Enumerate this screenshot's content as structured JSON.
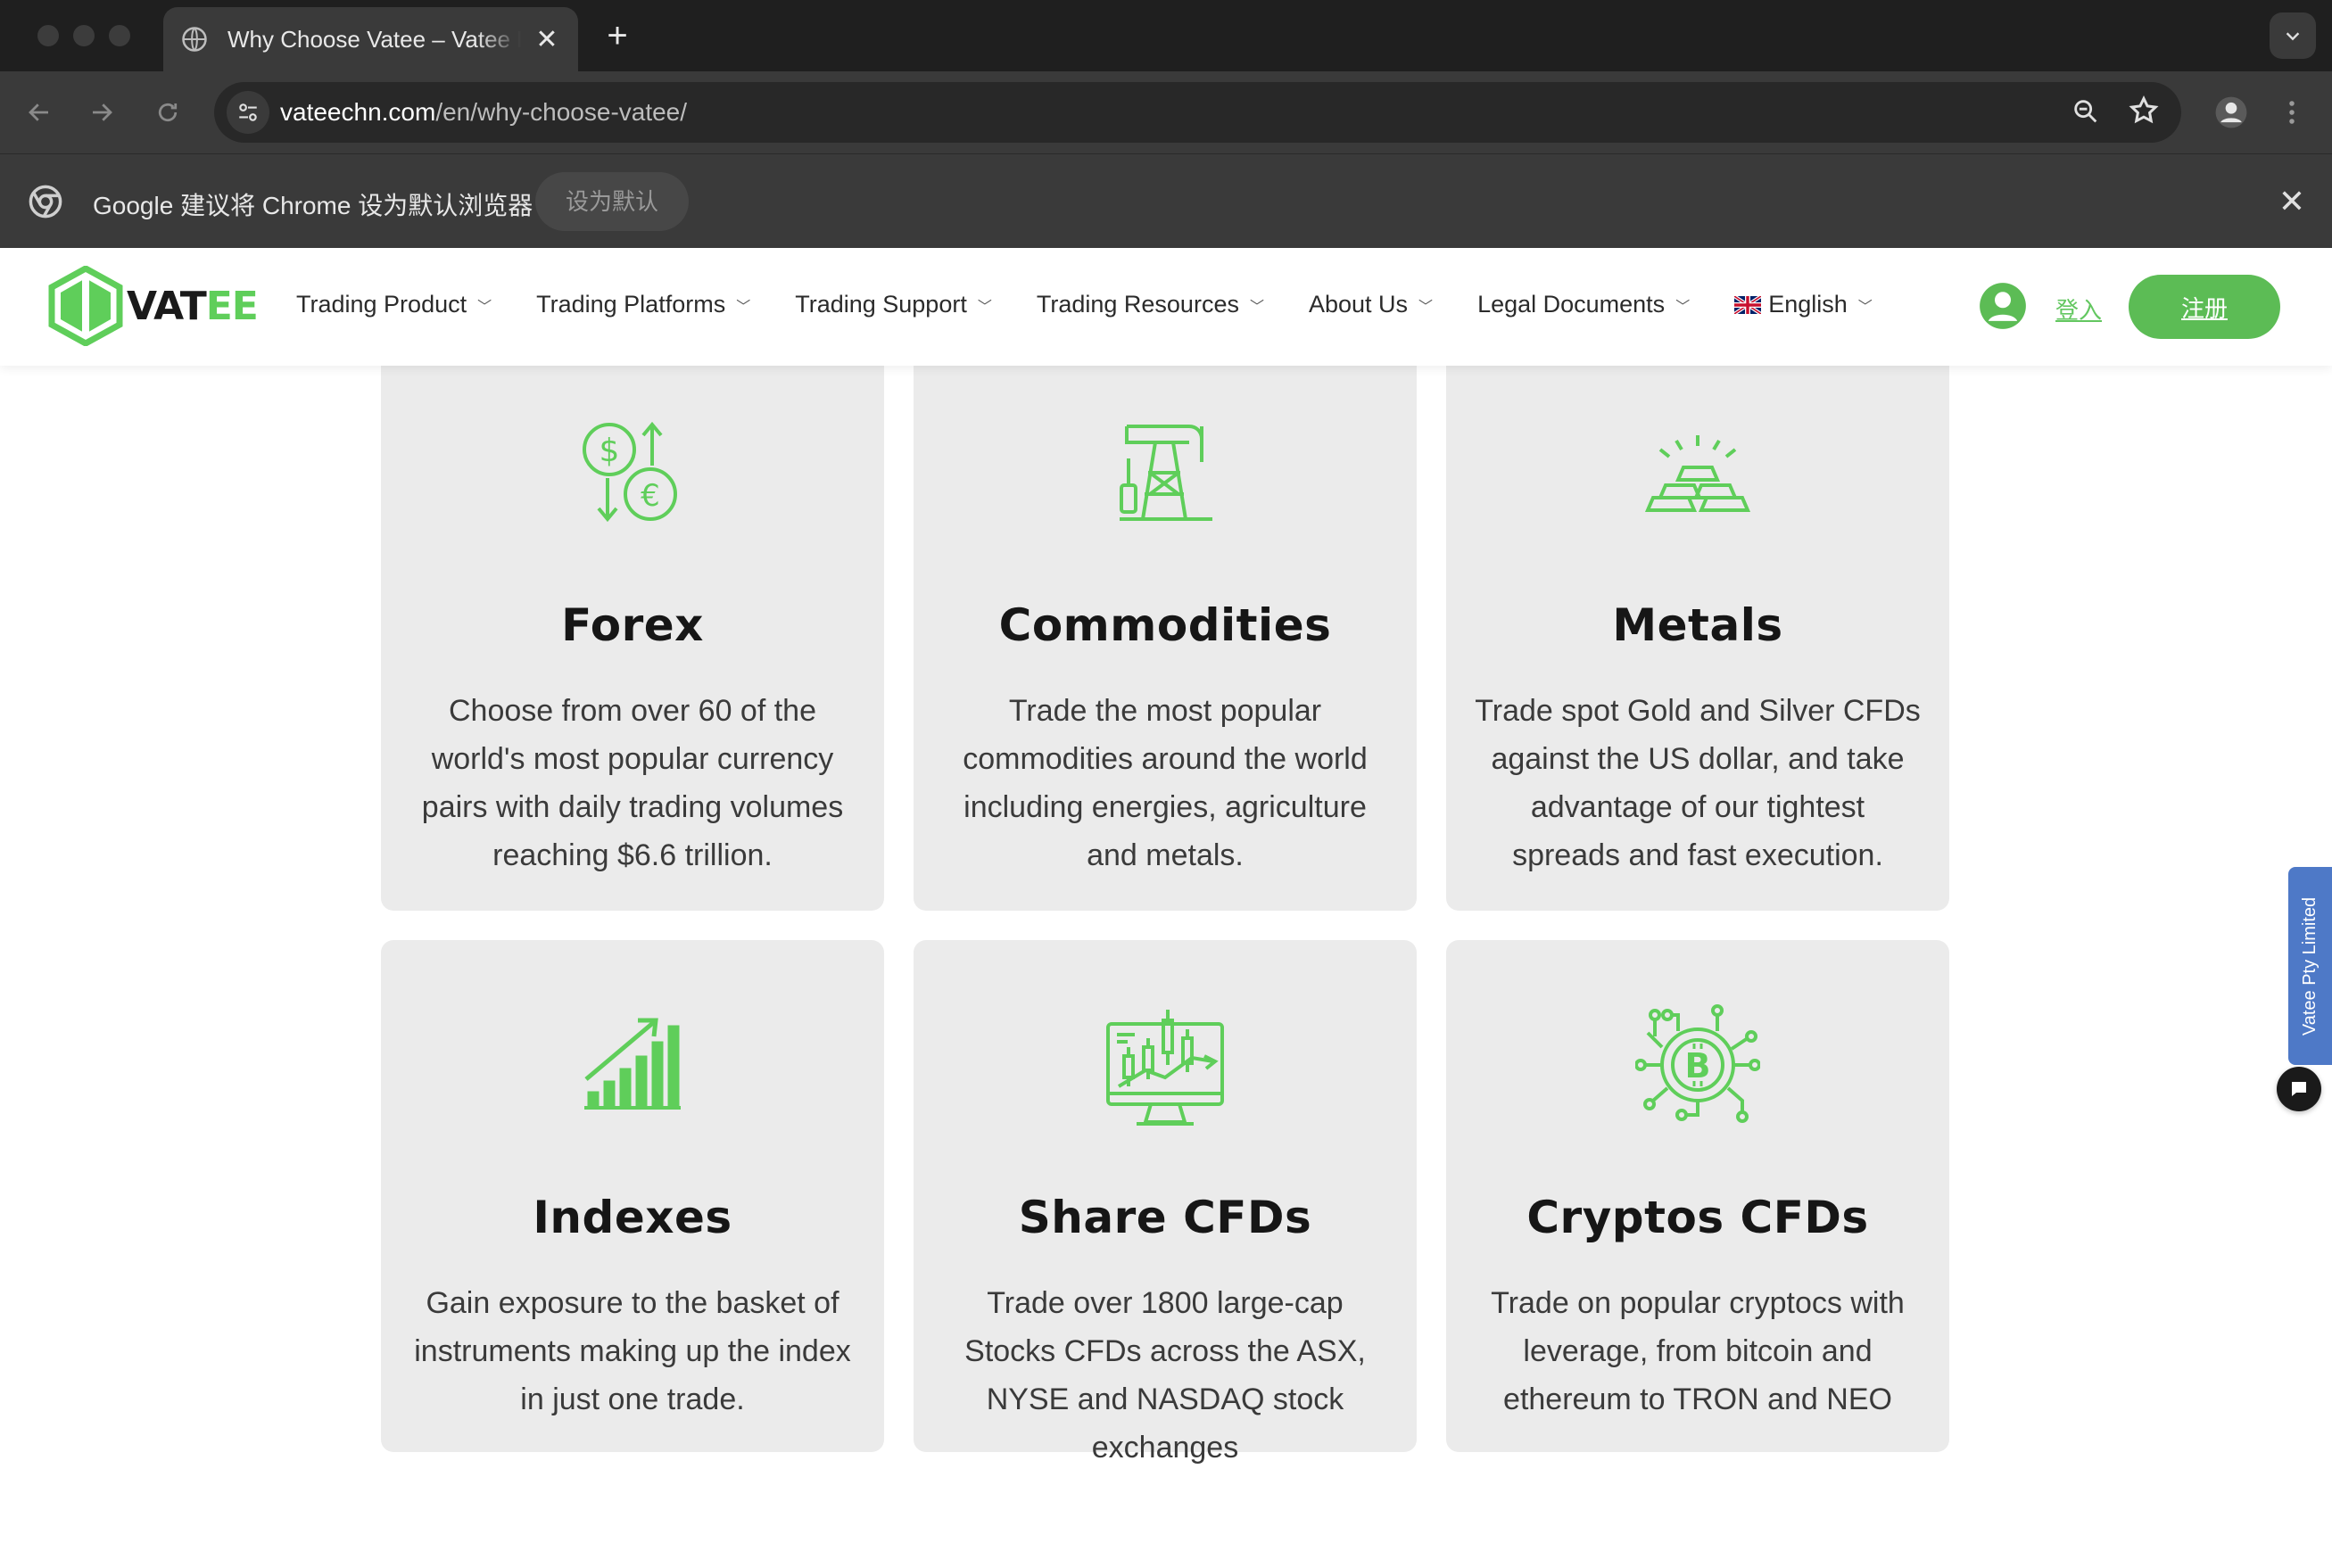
{
  "browser": {
    "tab_title": "Why Choose Vatee – Vatee Pty Limited",
    "url_host": "vateechn.com",
    "url_path": "/en/why-choose-vatee/",
    "infobar_message": "Google 建议将 Chrome 设为默认浏览器",
    "infobar_button": "设为默认"
  },
  "site": {
    "logo_text_a": "VAT",
    "logo_text_b": "EE",
    "nav": [
      {
        "label": "Trading Product"
      },
      {
        "label": "Trading Platforms"
      },
      {
        "label": "Trading Support"
      },
      {
        "label": "Trading Resources"
      },
      {
        "label": "About Us"
      },
      {
        "label": "Legal Documents"
      },
      {
        "label": "English"
      }
    ],
    "login_label": "登入",
    "signup_label": "注册"
  },
  "cards": [
    {
      "title": "Forex",
      "text": "Choose from over 60 of the world's most popular currency pairs with daily trading volumes reaching $6.6 trillion.",
      "icon": "forex-exchange-icon"
    },
    {
      "title": "Commodities",
      "text": "Trade the most popular commodities around the world including energies, agriculture and metals.",
      "icon": "oil-pump-icon"
    },
    {
      "title": "Metals",
      "text": "Trade spot Gold and Silver CFDs against the US dollar, and take advantage of our tightest spreads and fast execution.",
      "icon": "gold-bars-icon"
    },
    {
      "title": "Indexes",
      "text": "Gain exposure to the basket of instruments making up the index in just one trade.",
      "icon": "growth-chart-icon"
    },
    {
      "title": "Share CFDs",
      "text": "Trade over 1800 large-cap Stocks CFDs across the ASX, NYSE and NASDAQ stock exchanges",
      "icon": "stock-monitor-icon"
    },
    {
      "title": "Cryptos CFDs",
      "text": "Trade on popular cryptocs with leverage, from bitcoin and ethereum to TRON and NEO",
      "icon": "bitcoin-circuit-icon"
    }
  ],
  "side": {
    "tab_label": "Vatee Pty Limited"
  },
  "colors": {
    "accent_green": "#5fce5a",
    "button_green": "#5cbc55",
    "card_bg": "#ebebeb",
    "side_tab_blue": "#4e79c7"
  }
}
